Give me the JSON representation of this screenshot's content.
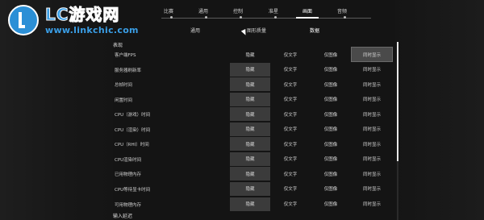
{
  "watermark": {
    "title": "LC游戏网",
    "url": "www.linkchic.com"
  },
  "top_menu": {
    "tabs": [
      "比赛",
      "通用",
      "控制",
      "准星",
      "画面",
      "音频"
    ],
    "active": "画面"
  },
  "sub_tabs": {
    "items": [
      "通用",
      "图形质量",
      "数据"
    ],
    "active": "数据"
  },
  "section_performance": "表现",
  "options": {
    "hide": "隐藏",
    "text_only": "仅文字",
    "graph_only": "仅图像",
    "both": "同时显示"
  },
  "rows": [
    {
      "label": "客户端FPS",
      "selected": "both"
    },
    {
      "label": "服务器刷新率",
      "selected": "hide"
    },
    {
      "label": "总帧时间",
      "selected": "hide"
    },
    {
      "label": "闲置时间",
      "selected": "hide"
    },
    {
      "label": "CPU（游戏）时间",
      "selected": "hide"
    },
    {
      "label": "CPU（渲染）时间",
      "selected": "hide"
    },
    {
      "label": "CPU（RHI）时间",
      "selected": "hide"
    },
    {
      "label": "CPU渲染时间",
      "selected": "hide"
    },
    {
      "label": "已用物理内存",
      "selected": "hide"
    },
    {
      "label": "CPU等待显卡时间",
      "selected": "hide"
    },
    {
      "label": "可用物理内存",
      "selected": "hide"
    }
  ],
  "section_input_latency": "输入延迟",
  "colors": {
    "selected_hide": "#3b3b3b",
    "selected_both": "#4a4a4a",
    "logo_blue": "#2b8fd6"
  }
}
